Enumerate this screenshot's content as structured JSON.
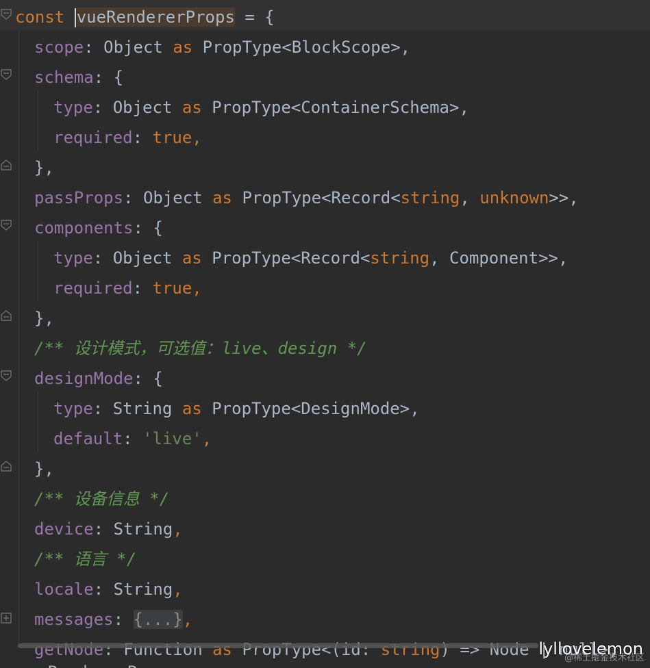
{
  "editor": {
    "colors": {
      "background": "#2b2b2b",
      "keyword": "#cc7832",
      "property": "#9876aa",
      "string": "#6a8759",
      "comment": "#629755",
      "text": "#a9b7c6"
    },
    "lines": {
      "l1": {
        "const": "const",
        "name": "vueRendererProps",
        "rest": " = {"
      },
      "l2": {
        "prop": "scope",
        "colon": ": ",
        "type": "Object ",
        "as": "as",
        "rest": " PropType<BlockScope>,"
      },
      "l3": {
        "prop": "schema",
        "rest": ": {"
      },
      "l4": {
        "prop": "type",
        "colon": ": ",
        "type": "Object ",
        "as": "as",
        "rest": " PropType<ContainerSchema>,"
      },
      "l5": {
        "prop": "required",
        "colon": ": ",
        "value": "true",
        "rest": ","
      },
      "l6": {
        "text": "},"
      },
      "l7": {
        "prop": "passProps",
        "colon": ": ",
        "type": "Object ",
        "as": "as",
        "mid": " PropType<Record<",
        "kw1": "string",
        "comma": ", ",
        "kw2": "unknown",
        "rest": ">>,"
      },
      "l8": {
        "prop": "components",
        "rest": ": {"
      },
      "l9": {
        "prop": "type",
        "colon": ": ",
        "type": "Object ",
        "as": "as",
        "mid": " PropType<Record<",
        "kw1": "string",
        "rest": ", Component>>,"
      },
      "l10": {
        "prop": "required",
        "colon": ": ",
        "value": "true",
        "rest": ","
      },
      "l11": {
        "text": "},"
      },
      "l12": {
        "comment": "/** 设计模式，可选值：live、design */"
      },
      "l13": {
        "prop": "designMode",
        "rest": ": {"
      },
      "l14": {
        "prop": "type",
        "colon": ": ",
        "type": "String ",
        "as": "as",
        "rest": " PropType<DesignMode>,"
      },
      "l15": {
        "prop": "default",
        "colon": ": ",
        "value": "'live'",
        "rest": ","
      },
      "l16": {
        "text": "},"
      },
      "l17": {
        "comment": "/** 设备信息 */"
      },
      "l18": {
        "prop": "device",
        "colon": ": ",
        "type": "String",
        "rest": ","
      },
      "l19": {
        "comment": "/** 语言 */"
      },
      "l20": {
        "prop": "locale",
        "colon": ": ",
        "type": "String",
        "rest": ","
      },
      "l21": {
        "prop": "messages",
        "colon": ": ",
        "folded": "{...}",
        "rest": ","
      },
      "l22": {
        "prop": "getNode",
        "colon": ": ",
        "type": "Function ",
        "as": "as",
        "mid": " PropType<(id: ",
        "kw1": "string",
        "rest": ") => Node | null>,"
      },
      "l23": {
        "text": "RendererProps"
      }
    }
  },
  "watermark": {
    "text": "lyllovelemon",
    "sub": "@稀土掘金技术社区"
  }
}
